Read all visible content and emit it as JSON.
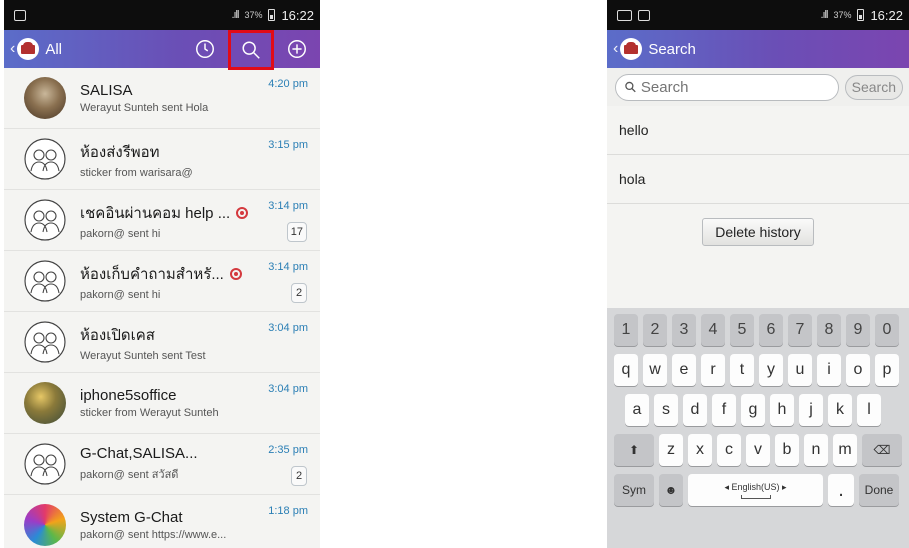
{
  "left_screen": {
    "status": {
      "signal": ".ıll",
      "battery": "37%",
      "time": "16:22"
    },
    "appbar": {
      "title": "All"
    },
    "chats": [
      {
        "name": "SALISA",
        "sub": "Werayut Sunteh sent Hola",
        "time": "4:20 pm",
        "badge": "",
        "avatar": "photo1",
        "pin": false
      },
      {
        "name": "ห้องส่งรีพอท",
        "sub": "sticker from warisara@",
        "time": "3:15 pm",
        "badge": "",
        "avatar": "group",
        "pin": false
      },
      {
        "name": "เชคอินผ่านคอม help ...",
        "sub": "pakorn@ sent hi",
        "time": "3:14 pm",
        "badge": "17",
        "avatar": "group",
        "pin": true
      },
      {
        "name": "ห้องเก็บคำถามสำหรั...",
        "sub": "pakorn@ sent hi",
        "time": "3:14 pm",
        "badge": "2",
        "avatar": "group",
        "pin": true
      },
      {
        "name": "ห้องเปิดเคส",
        "sub": "Werayut Sunteh sent Test",
        "time": "3:04 pm",
        "badge": "",
        "avatar": "group",
        "pin": false
      },
      {
        "name": "iphone5soffice",
        "sub": "sticker from Werayut Sunteh",
        "time": "3:04 pm",
        "badge": "",
        "avatar": "photo2",
        "pin": false
      },
      {
        "name": "G-Chat,SALISA...",
        "sub": "pakorn@ sent สวัสดี",
        "time": "2:35 pm",
        "badge": "2",
        "avatar": "group",
        "pin": false
      },
      {
        "name": "System G-Chat",
        "sub": "pakorn@ sent https://www.e...",
        "time": "1:18 pm",
        "badge": "",
        "avatar": "photo3",
        "pin": false
      }
    ]
  },
  "right_screen": {
    "status": {
      "signal": ".ıll",
      "battery": "37%",
      "time": "16:22"
    },
    "appbar": {
      "title": "Search"
    },
    "search": {
      "placeholder": "Search",
      "button": "Search"
    },
    "history": [
      "hello",
      "hola"
    ],
    "delete_button": "Delete history",
    "keyboard": {
      "row_numbers": [
        "1",
        "2",
        "3",
        "4",
        "5",
        "6",
        "7",
        "8",
        "9",
        "0"
      ],
      "row1": [
        "q",
        "w",
        "e",
        "r",
        "t",
        "y",
        "u",
        "i",
        "o",
        "p"
      ],
      "row2": [
        "a",
        "s",
        "d",
        "f",
        "g",
        "h",
        "j",
        "k",
        "l"
      ],
      "row3": [
        "z",
        "x",
        "c",
        "v",
        "b",
        "n",
        "m"
      ],
      "sym": "Sym",
      "language": "◂ English(US) ▸",
      "dot": ".",
      "done": "Done"
    }
  },
  "colors": {
    "appbar_start": "#5b6dc9",
    "appbar_end": "#7b45b0",
    "time_blue": "#2b7fb5",
    "highlight_red": "#e10b17"
  }
}
